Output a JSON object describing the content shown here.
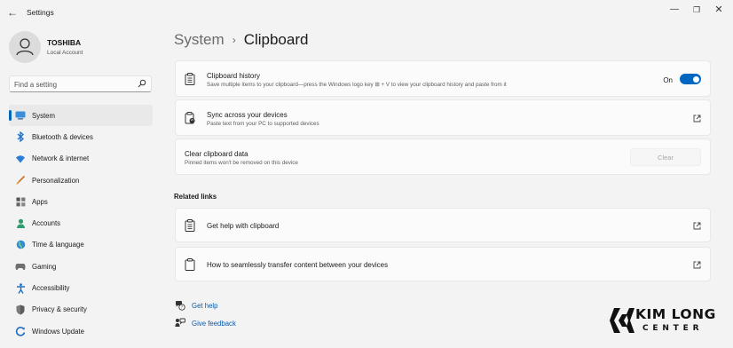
{
  "window": {
    "title": "Settings",
    "back_glyph": "←",
    "minimize_glyph": "—",
    "maximize_glyph": "❐",
    "close_glyph": "✕"
  },
  "account": {
    "name": "TOSHIBA",
    "type": "Local Account"
  },
  "search": {
    "placeholder": "Find a setting"
  },
  "nav": {
    "items": [
      {
        "label": "System",
        "icon": "system-icon",
        "active": true
      },
      {
        "label": "Bluetooth & devices",
        "icon": "bluetooth-icon"
      },
      {
        "label": "Network & internet",
        "icon": "network-icon"
      },
      {
        "label": "Personalization",
        "icon": "brush-icon"
      },
      {
        "label": "Apps",
        "icon": "apps-icon"
      },
      {
        "label": "Accounts",
        "icon": "accounts-icon"
      },
      {
        "label": "Time & language",
        "icon": "globe-icon"
      },
      {
        "label": "Gaming",
        "icon": "gaming-icon"
      },
      {
        "label": "Accessibility",
        "icon": "accessibility-icon"
      },
      {
        "label": "Privacy & security",
        "icon": "shield-icon"
      },
      {
        "label": "Windows Update",
        "icon": "update-icon"
      }
    ]
  },
  "header": {
    "parent": "System",
    "separator": "›",
    "current": "Clipboard"
  },
  "cards": {
    "history": {
      "title": "Clipboard history",
      "subtitle": "Save multiple items to your clipboard—press the Windows logo key ⊞ + V to view your clipboard history and paste from it",
      "toggle_state": "On",
      "toggle_on": true,
      "accent": "#0067c0"
    },
    "sync": {
      "title": "Sync across your devices",
      "subtitle": "Paste text from your PC to supported devices"
    },
    "clear": {
      "title": "Clear clipboard data",
      "subtitle": "Pinned items won't be removed on this device",
      "button_label": "Clear",
      "button_enabled": false
    }
  },
  "related": {
    "heading": "Related links",
    "links": [
      {
        "label": "Get help with clipboard"
      },
      {
        "label": "How to seamlessly transfer content between your devices"
      }
    ]
  },
  "footer": {
    "get_help": "Get help",
    "give_feedback": "Give feedback"
  },
  "logo": {
    "line1": "KIM LONG",
    "line2": "CENTER"
  }
}
